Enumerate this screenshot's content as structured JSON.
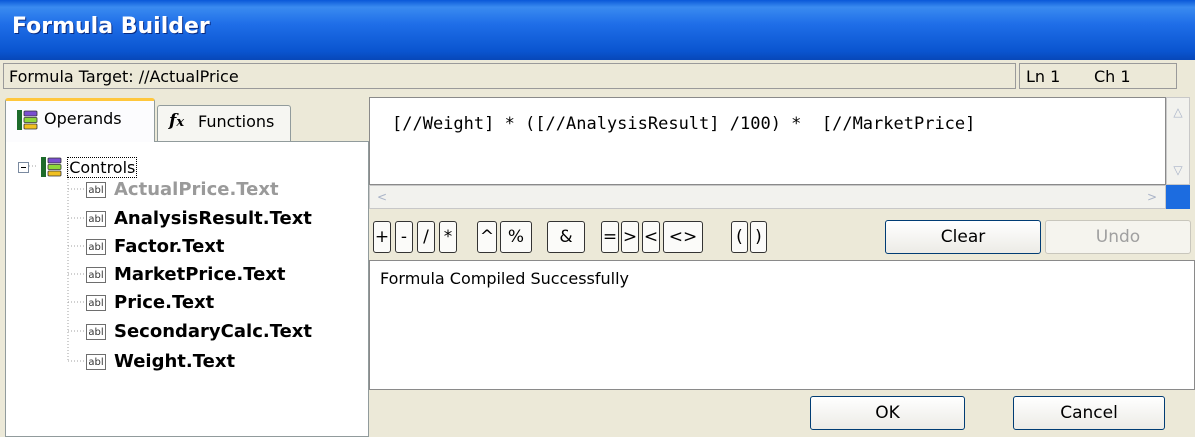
{
  "window": {
    "title": "Formula Builder"
  },
  "target": {
    "label": "Formula Target: //ActualPrice",
    "line": "Ln 1",
    "column": "Ch 1"
  },
  "tabs": [
    {
      "label": "Operands",
      "icon": "operands-icon",
      "active": true
    },
    {
      "label": "Functions",
      "icon": "function-icon",
      "active": false
    }
  ],
  "tree": {
    "root": {
      "label": "Controls",
      "icon": "controls-icon",
      "expanded": true
    },
    "items": [
      {
        "label": "ActualPrice.Text",
        "icon": "abl",
        "disabled": true
      },
      {
        "label": "AnalysisResult.Text",
        "icon": "abl",
        "disabled": false
      },
      {
        "label": "Factor.Text",
        "icon": "abl",
        "disabled": false
      },
      {
        "label": "MarketPrice.Text",
        "icon": "abl",
        "disabled": false
      },
      {
        "label": "Price.Text",
        "icon": "abl",
        "disabled": false
      },
      {
        "label": "SecondaryCalc.Text",
        "icon": "abl",
        "disabled": false
      },
      {
        "label": "Weight.Text",
        "icon": "abl",
        "disabled": false
      }
    ]
  },
  "editor": {
    "formula": "[//Weight] * ([//AnalysisResult] /100) *  [//MarketPrice]"
  },
  "operators": [
    "+",
    "-",
    "/",
    "*",
    "^",
    "%",
    "&",
    "=",
    ">",
    "<",
    "<>",
    "(",
    ")"
  ],
  "buttons": {
    "clear": "Clear",
    "undo": "Undo",
    "ok": "OK",
    "cancel": "Cancel"
  },
  "output": {
    "message": "Formula Compiled Successfully"
  },
  "colors": {
    "title_bar": "#0a55d0",
    "tab_highlight": "#ffc73c",
    "disabled_text": "#9a9a9a"
  }
}
